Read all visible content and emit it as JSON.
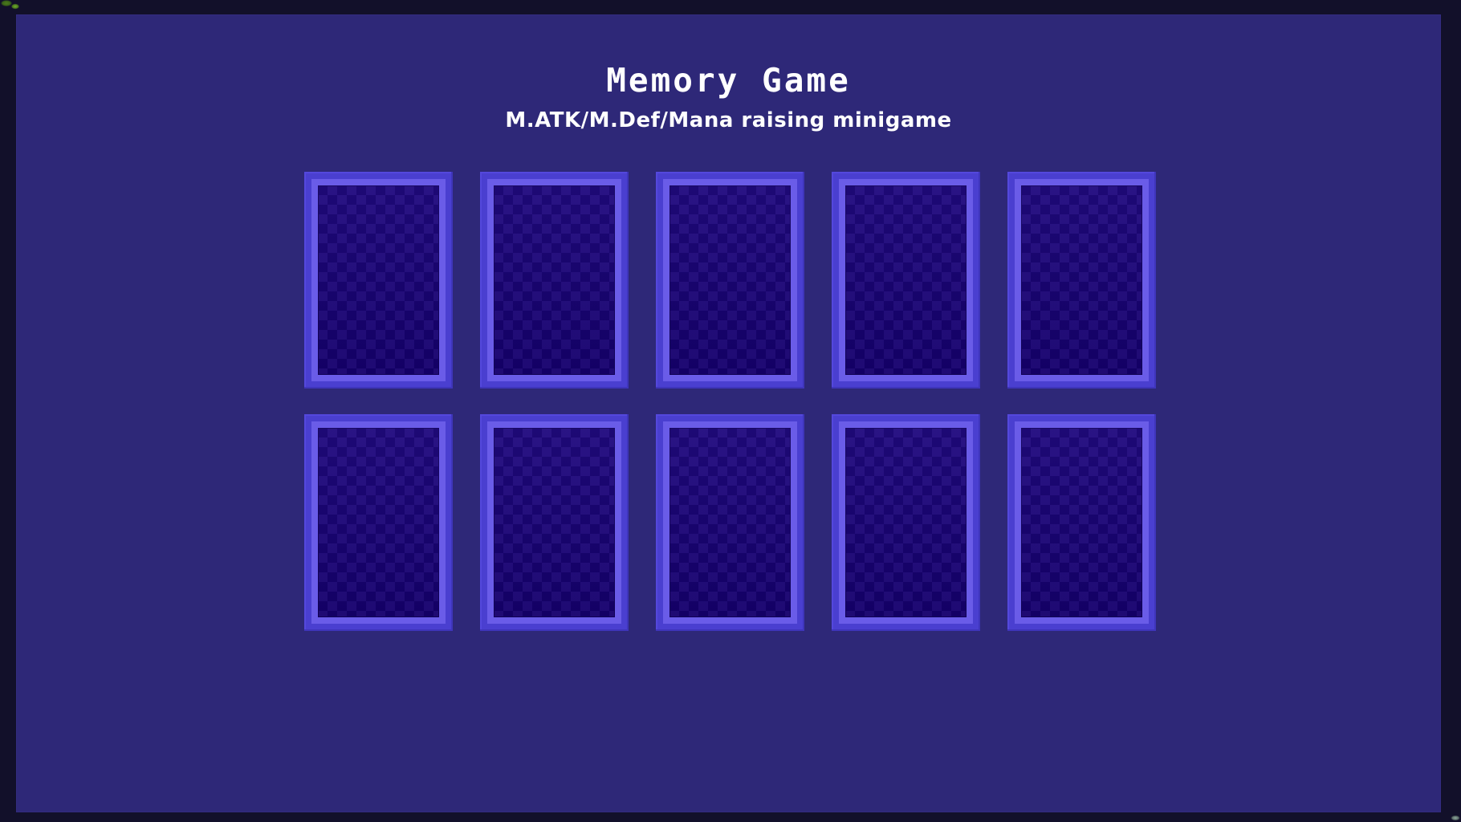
{
  "window": {
    "frame_color": "#12102a",
    "panel_color": "#2e2878"
  },
  "header": {
    "title": "Memory Game",
    "subtitle": "M.ATK/M.Def/Mana raising minigame"
  },
  "board": {
    "rows": 2,
    "columns": 5,
    "total_cards": 10,
    "card_state": "face-down",
    "card_border_color": "#4a3fd0",
    "card_rim_color": "#6a5ce8",
    "card_face_color": "#150070",
    "cards": [
      {
        "id": 1,
        "row": 1,
        "column": 1,
        "face_up": false,
        "value": ""
      },
      {
        "id": 2,
        "row": 1,
        "column": 2,
        "face_up": false,
        "value": ""
      },
      {
        "id": 3,
        "row": 1,
        "column": 3,
        "face_up": false,
        "value": ""
      },
      {
        "id": 4,
        "row": 1,
        "column": 4,
        "face_up": false,
        "value": ""
      },
      {
        "id": 5,
        "row": 1,
        "column": 5,
        "face_up": false,
        "value": ""
      },
      {
        "id": 6,
        "row": 2,
        "column": 1,
        "face_up": false,
        "value": ""
      },
      {
        "id": 7,
        "row": 2,
        "column": 2,
        "face_up": false,
        "value": ""
      },
      {
        "id": 8,
        "row": 2,
        "column": 3,
        "face_up": false,
        "value": ""
      },
      {
        "id": 9,
        "row": 2,
        "column": 4,
        "face_up": false,
        "value": ""
      },
      {
        "id": 10,
        "row": 2,
        "column": 5,
        "face_up": false,
        "value": ""
      }
    ]
  }
}
